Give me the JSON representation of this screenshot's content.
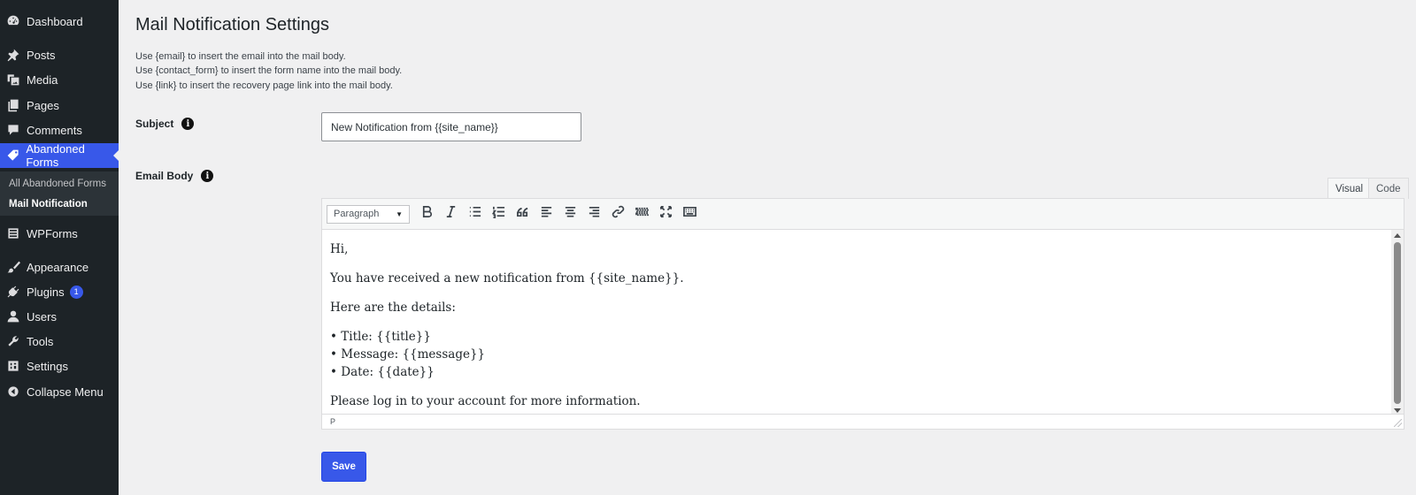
{
  "sidebar": {
    "items": [
      {
        "label": "Dashboard",
        "icon": "dashboard-icon"
      },
      {
        "label": "Posts",
        "icon": "pin-icon"
      },
      {
        "label": "Media",
        "icon": "media-icon"
      },
      {
        "label": "Pages",
        "icon": "pages-icon"
      },
      {
        "label": "Comments",
        "icon": "comment-icon"
      },
      {
        "label": "Abandoned Forms",
        "icon": "tag-icon"
      },
      {
        "label": "WPForms",
        "icon": "form-icon"
      },
      {
        "label": "Appearance",
        "icon": "brush-icon"
      },
      {
        "label": "Plugins",
        "icon": "plugin-icon",
        "badge": "1"
      },
      {
        "label": "Users",
        "icon": "user-icon"
      },
      {
        "label": "Tools",
        "icon": "wrench-icon"
      },
      {
        "label": "Settings",
        "icon": "settings-icon"
      },
      {
        "label": "Collapse Menu",
        "icon": "collapse-icon"
      }
    ],
    "submenu": [
      {
        "label": "All Abandoned Forms"
      },
      {
        "label": "Mail Notification"
      }
    ],
    "accent_color": "#3858e9"
  },
  "main": {
    "title": "Mail Notification Settings",
    "help_lines": [
      "Use {email} to insert the email into the mail body.",
      "Use {contact_form} to insert the form name into the mail body.",
      "Use {link} to insert the recovery page link into the mail body."
    ],
    "subject": {
      "label": "Subject",
      "value": "New Notification from {{site_name}}"
    },
    "email_body": {
      "label": "Email Body",
      "tabs": [
        "Visual",
        "Code"
      ],
      "format_select": "Paragraph",
      "paragraphs": [
        "Hi,",
        "You have received a new notification from {{site_name}}.",
        "Here are the details:"
      ],
      "list_lines": [
        "• Title: {{title}}",
        "• Message: {{message}}",
        "• Date: {{date}}"
      ],
      "closing": "Please log in to your account for more information.",
      "status_path": "P"
    },
    "save_label": "Save"
  }
}
